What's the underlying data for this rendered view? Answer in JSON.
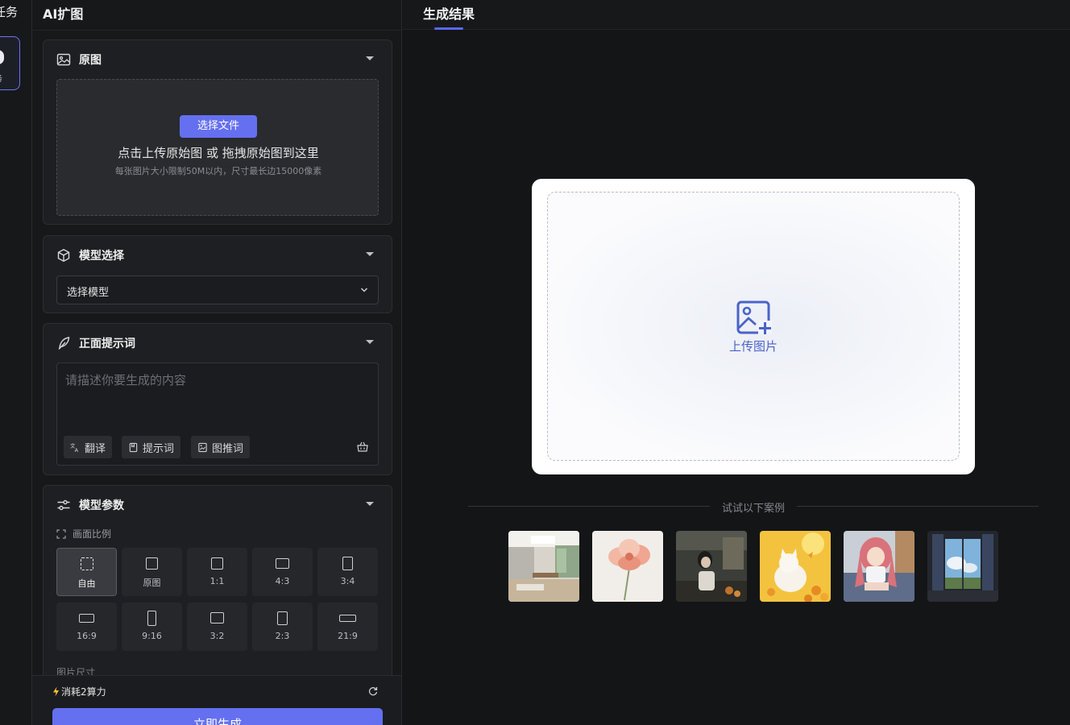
{
  "rail": {
    "title": "任务",
    "item_label": "务"
  },
  "panel": {
    "title": "AI扩图"
  },
  "original": {
    "header": "原图",
    "pick_button": "选择文件",
    "drop_text": "点击上传原始图 或 拖拽原始图到这里",
    "limit_text": "每张图片大小限制50M以内，尺寸最长边15000像素"
  },
  "model": {
    "header": "模型选择",
    "selected": "选择模型"
  },
  "prompt": {
    "header": "正面提示词",
    "placeholder": "请描述你要生成的内容",
    "tools": [
      "翻译",
      "提示词",
      "图推词"
    ]
  },
  "params": {
    "header": "模型参数",
    "ratio_label": "画面比例",
    "ratios": [
      "自由",
      "原图",
      "1:1",
      "4:3",
      "3:4",
      "16:9",
      "9:16",
      "3:2",
      "2:3",
      "21:9"
    ],
    "active_ratio": "自由",
    "size_label": "图片尺寸"
  },
  "footer": {
    "cost": "消耗2算力",
    "generate": "立即生成"
  },
  "result": {
    "tab": "生成结果",
    "upload_text": "上传图片",
    "try_text": "试试以下案例",
    "examples": [
      "modern-kitchen",
      "pink-flower",
      "girl-in-kitchen",
      "cat-in-flowers",
      "anime-girl",
      "window-view"
    ]
  },
  "colors": {
    "accent": "#6470f0",
    "panel_bg": "#17181a",
    "card_bg": "#1e1f22",
    "upload_text": "#4a63c9"
  }
}
